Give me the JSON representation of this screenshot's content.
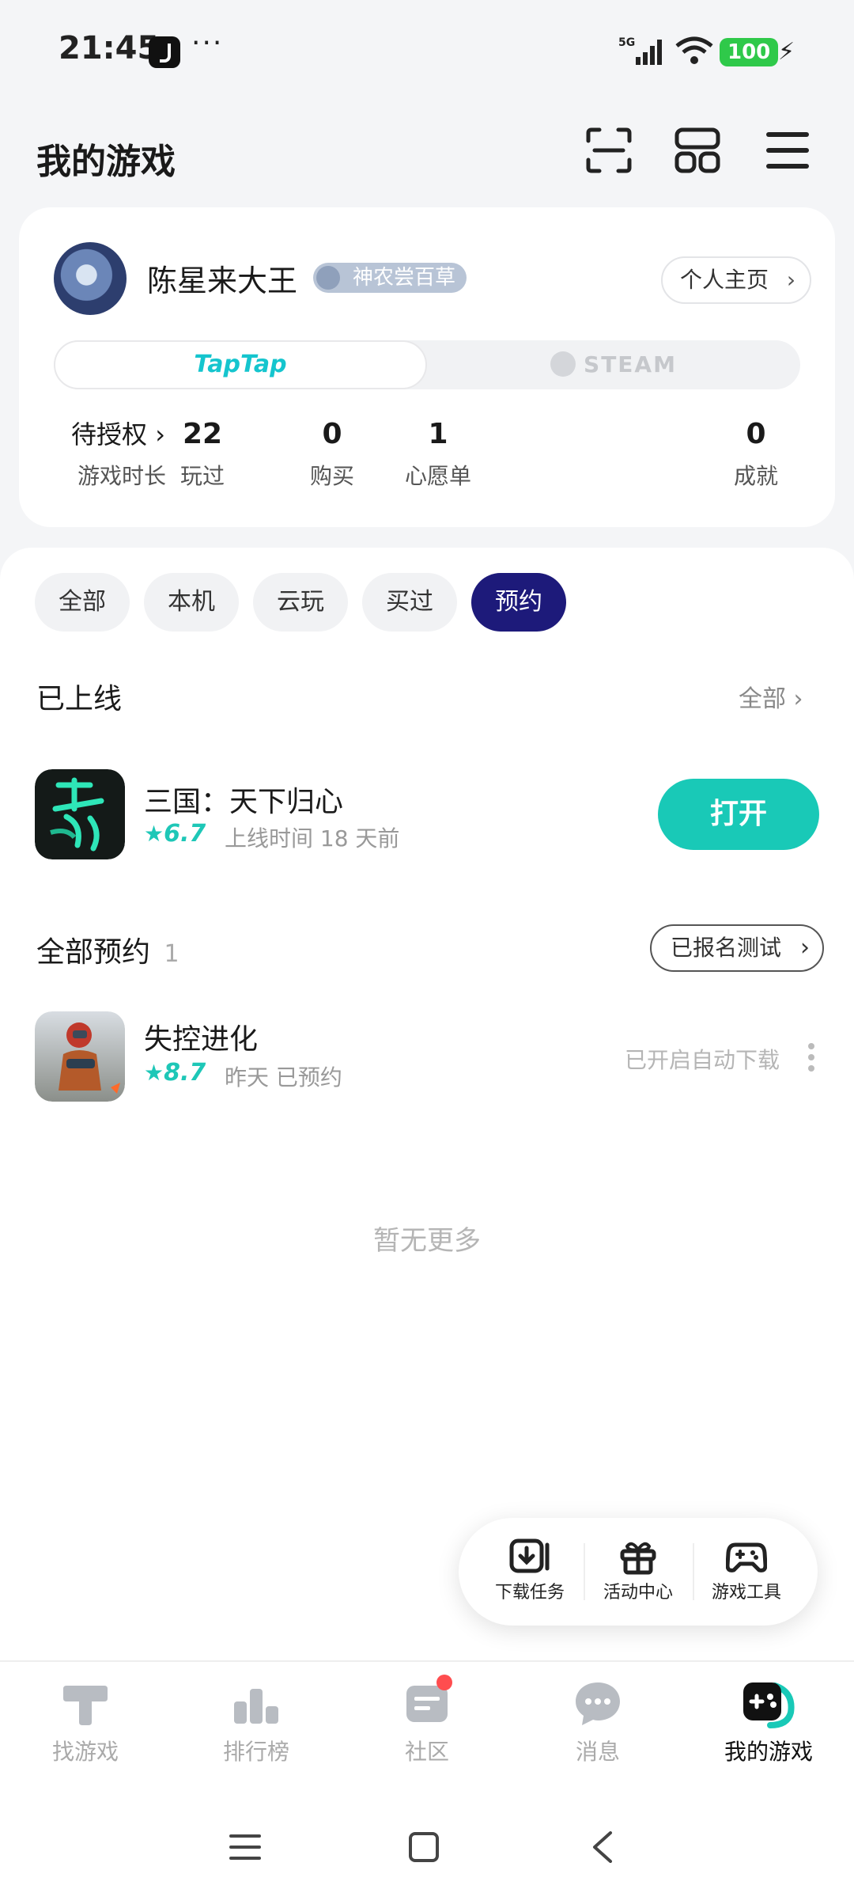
{
  "status_bar": {
    "time": "21:45",
    "more": "···",
    "network": "5G",
    "battery": "100"
  },
  "header": {
    "title": "我的游戏",
    "icons": [
      "scan-icon",
      "grid-icon",
      "menu-icon"
    ]
  },
  "profile": {
    "username": "陈星来大王",
    "title_badge": "神农尝百草",
    "profile_link": "个人主页",
    "platforms": [
      "TapTap",
      "STEAM"
    ],
    "stats": [
      {
        "value": "待授权",
        "label": "游戏时长"
      },
      {
        "value": "22",
        "label": "玩过"
      },
      {
        "value": "0",
        "label": "购买"
      },
      {
        "value": "1",
        "label": "心愿单"
      },
      {
        "value": "0",
        "label": "成就"
      }
    ]
  },
  "filters": [
    "全部",
    "本机",
    "云玩",
    "买过",
    "预约"
  ],
  "active_filter": "预约",
  "online_section": {
    "title": "已上线",
    "more": "全部",
    "game": {
      "name": "三国：天下归心",
      "rating": "6.7",
      "meta": "上线时间 18 天前",
      "action": "打开"
    }
  },
  "reserve_section": {
    "title": "全部预约",
    "count": "1",
    "test_button": "已报名测试",
    "game": {
      "name": "失控进化",
      "rating": "8.7",
      "meta": "昨天 已预约",
      "status": "已开启自动下载"
    }
  },
  "end_text": "暂无更多",
  "tools": [
    {
      "label": "下载任务",
      "icon": "download-icon"
    },
    {
      "label": "活动中心",
      "icon": "gift-icon"
    },
    {
      "label": "游戏工具",
      "icon": "gamepad-icon"
    }
  ],
  "bottom_nav": [
    {
      "label": "找游戏",
      "icon": "find-game-icon"
    },
    {
      "label": "排行榜",
      "icon": "ranking-icon"
    },
    {
      "label": "社区",
      "icon": "community-icon"
    },
    {
      "label": "消息",
      "icon": "message-icon"
    },
    {
      "label": "我的游戏",
      "icon": "my-games-icon"
    }
  ],
  "colors": {
    "accent": "#19c9b7",
    "active_chip": "#1d1a7a",
    "badge": "#ff4d4f"
  }
}
